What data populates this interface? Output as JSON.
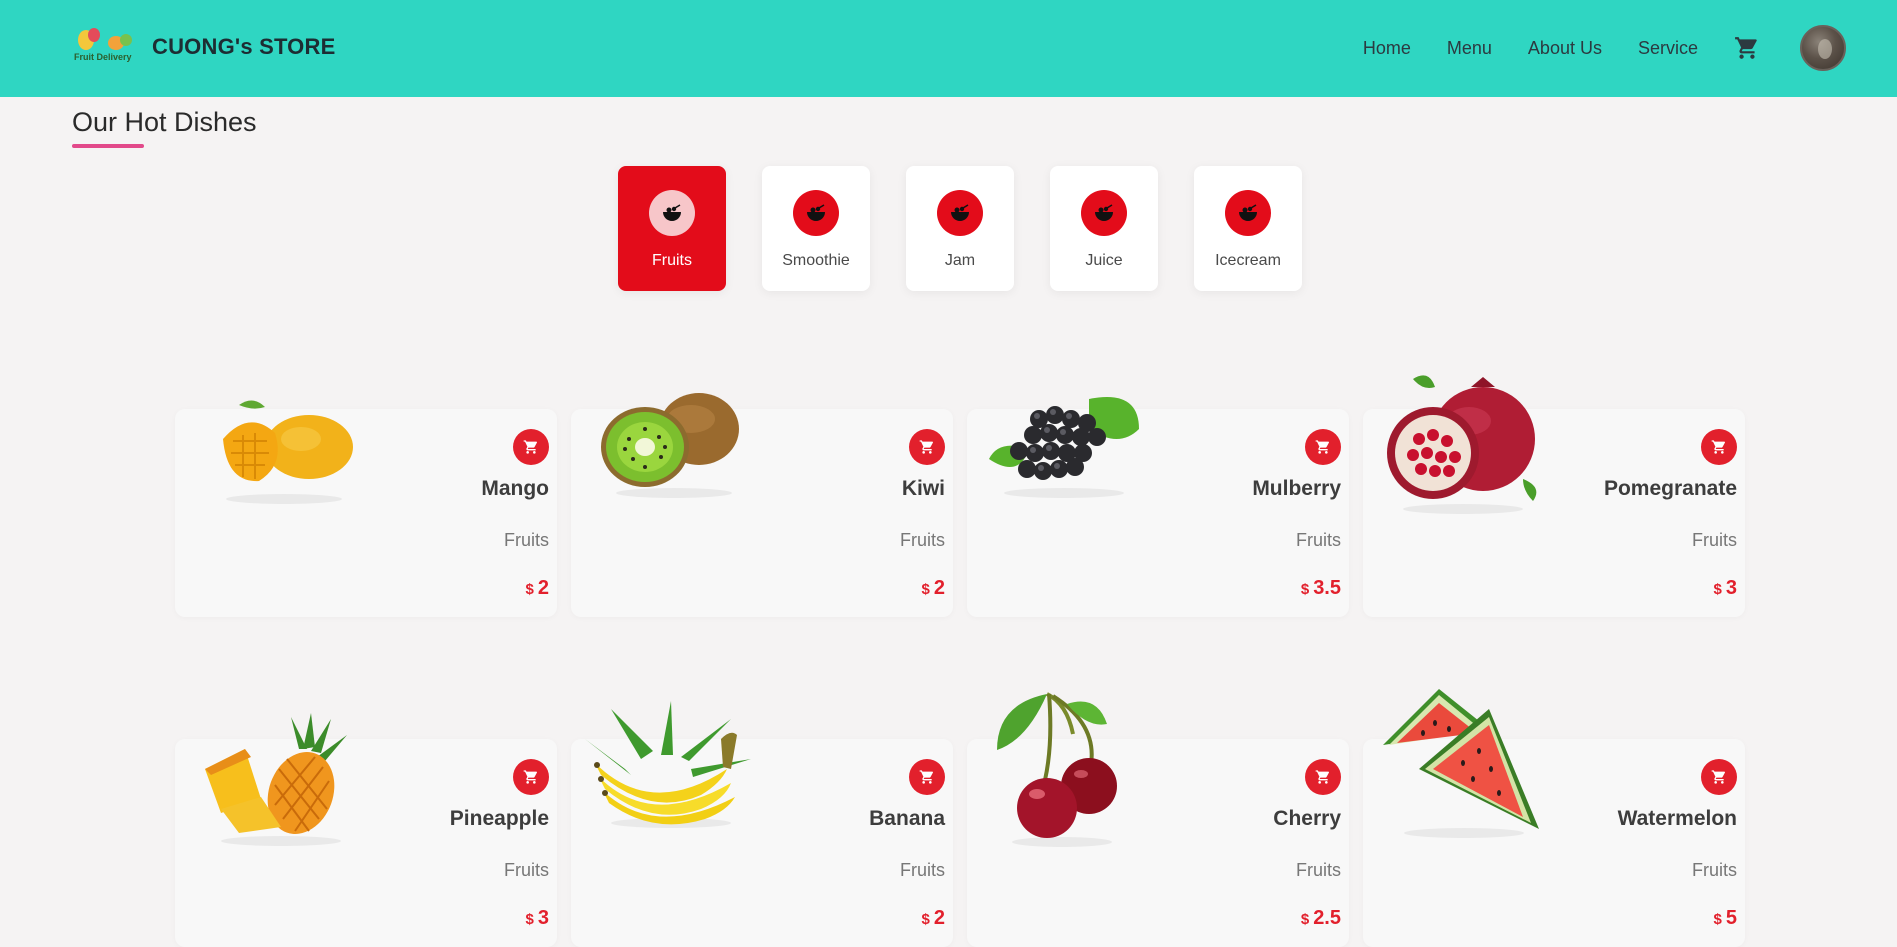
{
  "header": {
    "logo_text": "Fruit Delivery",
    "brand": "CUONG's STORE",
    "nav": [
      "Home",
      "Menu",
      "About Us",
      "Service"
    ],
    "cart_icon": "cart-icon",
    "bg_color": "#2fd6c2"
  },
  "section": {
    "title": "Our Hot Dishes",
    "accent": "#e2498a"
  },
  "categories": [
    {
      "label": "Fruits",
      "active": true
    },
    {
      "label": "Smoothie",
      "active": false
    },
    {
      "label": "Jam",
      "active": false
    },
    {
      "label": "Juice",
      "active": false
    },
    {
      "label": "Icecream",
      "active": false
    }
  ],
  "products": [
    {
      "name": "Mango",
      "category": "Fruits",
      "currency": "$",
      "price": "2"
    },
    {
      "name": "Kiwi",
      "category": "Fruits",
      "currency": "$",
      "price": "2"
    },
    {
      "name": "Mulberry",
      "category": "Fruits",
      "currency": "$",
      "price": "3.5"
    },
    {
      "name": "Pomegranate",
      "category": "Fruits",
      "currency": "$",
      "price": "3"
    },
    {
      "name": "Pineapple",
      "category": "Fruits",
      "currency": "$",
      "price": "3"
    },
    {
      "name": "Banana",
      "category": "Fruits",
      "currency": "$",
      "price": "2"
    },
    {
      "name": "Cherry",
      "category": "Fruits",
      "currency": "$",
      "price": "2.5"
    },
    {
      "name": "Watermelon",
      "category": "Fruits",
      "currency": "$",
      "price": "5"
    }
  ],
  "colors": {
    "primary_red": "#e30c1a",
    "price_red": "#e2202c"
  }
}
